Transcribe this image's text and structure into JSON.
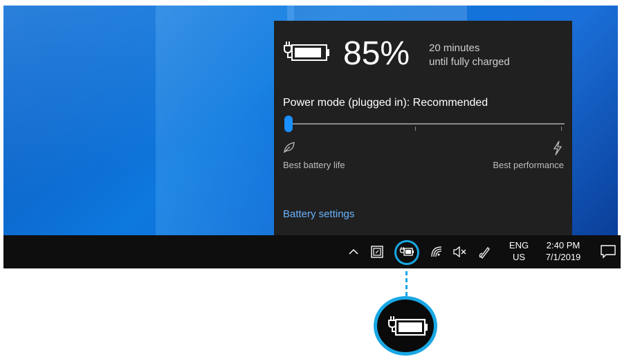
{
  "flyout": {
    "battery_percent": "85%",
    "charge_line1": "20 minutes",
    "charge_line2": "until fully charged",
    "power_mode_label": "Power mode (plugged in): Recommended",
    "slider_left_label": "Best battery life",
    "slider_right_label": "Best performance",
    "settings_link": "Battery settings",
    "icons": [
      "battery-charging-icon",
      "leaf-icon",
      "lightning-icon"
    ]
  },
  "taskbar": {
    "lang_line1": "ENG",
    "lang_line2": "US",
    "time": "2:40 PM",
    "date": "7/1/2019",
    "icons": [
      "chevron-up-icon",
      "tablet-icon",
      "battery-charging-icon",
      "wifi-icon",
      "volume-muted-icon",
      "pen-icon",
      "notifications-icon"
    ]
  },
  "callout": {
    "icon": "battery-charging-icon",
    "accent": "#19a7e4"
  },
  "colors": {
    "flyout_bg": "#202020",
    "link": "#6ab3ff",
    "slider_thumb": "#1a8fff",
    "taskbar_bg": "#0e0e0e"
  }
}
